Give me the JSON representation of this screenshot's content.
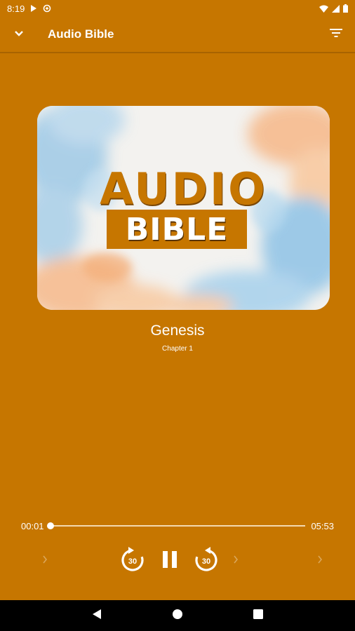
{
  "status_bar": {
    "time": "8:19",
    "icons": [
      "play-icon",
      "data-saver-icon",
      "wifi-icon",
      "signal-icon",
      "battery-icon"
    ]
  },
  "app_bar": {
    "title": "Audio Bible",
    "left_icon": "chevron-down-icon",
    "right_icon": "filter-icon"
  },
  "cover": {
    "line1": "AUDIO",
    "line2": "BIBLE"
  },
  "track": {
    "title": "Genesis",
    "subtitle": "Chapter 1"
  },
  "progress": {
    "current": "00:01",
    "total": "05:53",
    "fraction": 0.003
  },
  "controls": {
    "icons": [
      "chevron-right-icon",
      "replay-30-icon",
      "pause-icon",
      "forward-30-icon",
      "chevron-right-icon",
      "chevron-right-icon"
    ],
    "replay_label": "30",
    "forward_label": "30"
  },
  "nav_bar": {
    "icons": [
      "back-icon",
      "home-icon",
      "recents-icon"
    ]
  },
  "colors": {
    "background": "#c67600",
    "accent": "#ffffff"
  }
}
